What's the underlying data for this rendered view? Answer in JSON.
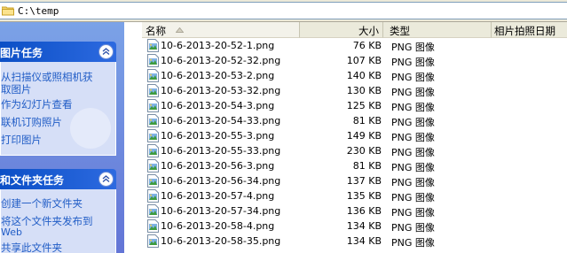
{
  "address": {
    "path": "C:\\temp"
  },
  "taskpane": {
    "picture_tasks": {
      "title": "图片任务",
      "items": [
        "从扫描仪或照相机获",
        "取图片",
        "作为幻灯片查看",
        "联机订购照片",
        "打印图片"
      ]
    },
    "file_tasks": {
      "title": "和文件夹任务",
      "items": [
        "创建一个新文件夹",
        "将这个文件夹发布到",
        "Web",
        "共享此文件夹"
      ]
    }
  },
  "columns": {
    "name": "名称",
    "size": "大小",
    "type": "类型",
    "date_taken": "相片拍照日期"
  },
  "files": [
    {
      "name": "10-6-2013-20-52-1.png",
      "size": "76 KB",
      "type": "PNG 图像"
    },
    {
      "name": "10-6-2013-20-52-32.png",
      "size": "107 KB",
      "type": "PNG 图像"
    },
    {
      "name": "10-6-2013-20-53-2.png",
      "size": "140 KB",
      "type": "PNG 图像"
    },
    {
      "name": "10-6-2013-20-53-32.png",
      "size": "130 KB",
      "type": "PNG 图像"
    },
    {
      "name": "10-6-2013-20-54-3.png",
      "size": "125 KB",
      "type": "PNG 图像"
    },
    {
      "name": "10-6-2013-20-54-33.png",
      "size": "81 KB",
      "type": "PNG 图像"
    },
    {
      "name": "10-6-2013-20-55-3.png",
      "size": "149 KB",
      "type": "PNG 图像"
    },
    {
      "name": "10-6-2013-20-55-33.png",
      "size": "230 KB",
      "type": "PNG 图像"
    },
    {
      "name": "10-6-2013-20-56-3.png",
      "size": "81 KB",
      "type": "PNG 图像"
    },
    {
      "name": "10-6-2013-20-56-34.png",
      "size": "137 KB",
      "type": "PNG 图像"
    },
    {
      "name": "10-6-2013-20-57-4.png",
      "size": "135 KB",
      "type": "PNG 图像"
    },
    {
      "name": "10-6-2013-20-57-34.png",
      "size": "136 KB",
      "type": "PNG 图像"
    },
    {
      "name": "10-6-2013-20-58-4.png",
      "size": "134 KB",
      "type": "PNG 图像"
    },
    {
      "name": "10-6-2013-20-58-35.png",
      "size": "134 KB",
      "type": "PNG 图像"
    }
  ],
  "colors": {
    "link": "#215dc6",
    "header_blue": "#0b4fc6",
    "pane_bg": "#7ba2e7"
  }
}
